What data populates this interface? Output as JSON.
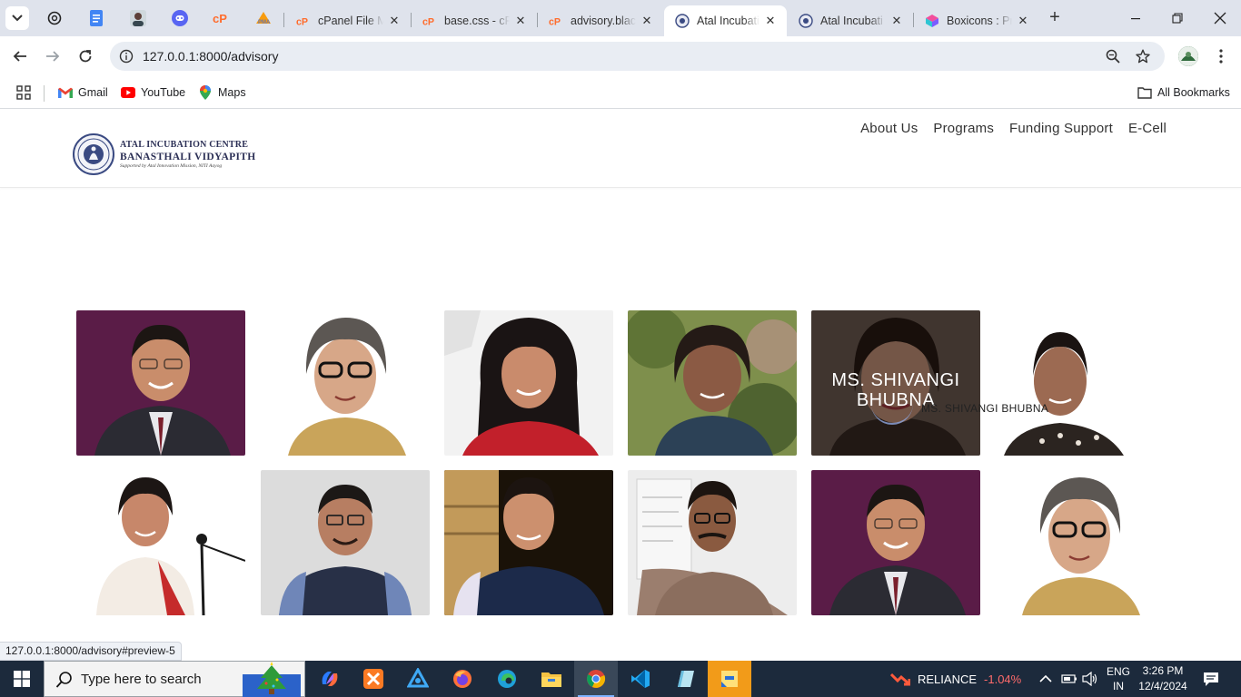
{
  "browser": {
    "tabs": [
      {
        "title": "cPanel File M",
        "favicon": "cpanel-icon",
        "closable": true
      },
      {
        "title": "base.css - cP",
        "favicon": "cpanel-icon",
        "closable": true
      },
      {
        "title": "advisory.blac",
        "favicon": "cpanel-icon",
        "closable": true
      },
      {
        "title": "Atal Incubati",
        "favicon": "aic-seal-icon",
        "closable": true,
        "active": true
      },
      {
        "title": "Atal Incubati",
        "favicon": "aic-seal-icon",
        "closable": true
      },
      {
        "title": "Boxicons : Pr",
        "favicon": "boxicons-icon",
        "closable": true
      }
    ],
    "pinned_tabs": [
      "chatgpt-icon",
      "docs-icon",
      "avatar-icon",
      "discord-icon",
      "cpanel-icon",
      "phpmyadmin-icon"
    ],
    "url": "127.0.0.1:8000/advisory",
    "bookmarks": [
      {
        "label": "Gmail",
        "icon": "gmail-icon"
      },
      {
        "label": "YouTube",
        "icon": "youtube-icon"
      },
      {
        "label": "Maps",
        "icon": "maps-icon"
      }
    ],
    "all_bookmarks_label": "All Bookmarks",
    "status_url": "127.0.0.1:8000/advisory#preview-5"
  },
  "site": {
    "logo": {
      "line1": "ATAL INCUBATION CENTRE",
      "line2": "BANASTHALI VIDYAPITH",
      "line3": "Supported by Atal Innovation Mission, NITI Aayog"
    },
    "nav": [
      "About Us",
      "Programs",
      "Funding Support",
      "E-Cell"
    ],
    "advisory": {
      "hover_name": "MS. SHIVANGI BHUBNA",
      "hover_caption": "MS. SHIVANGI BHUBNA"
    }
  },
  "taskbar": {
    "search_placeholder": "Type here to search",
    "stock_name": "RELIANCE",
    "stock_change": "-1.04%",
    "lang_line1": "ENG",
    "lang_line2": "IN",
    "time": "3:26 PM",
    "date": "12/4/2024"
  },
  "colors": {
    "stock_negative": "#ff6b6b",
    "accent": "#1a73e8"
  }
}
